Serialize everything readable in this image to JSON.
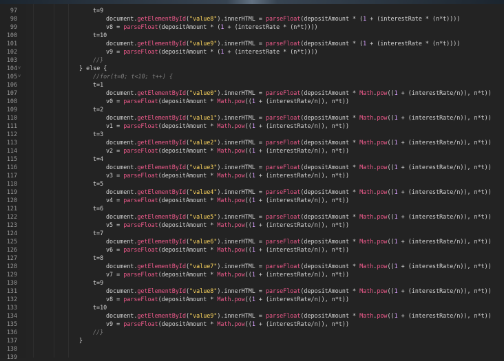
{
  "editor": {
    "lines": [
      {
        "n": "97",
        "code": "t=9",
        "indent": 0
      },
      {
        "n": "98",
        "code": "document.getElementById(\"value8\").innerHTML = parseFloat(depositAmount * (1 + (interestRate * (n*t))))",
        "indent": 1
      },
      {
        "n": "99",
        "code": "v8 = parseFloat(depositAmount * (1 + (interestRate * (n*t))))",
        "indent": 1
      },
      {
        "n": "100",
        "code": "t=10",
        "indent": 0
      },
      {
        "n": "101",
        "code": "document.getElementById(\"value9\").innerHTML = parseFloat(depositAmount * (1 + (interestRate * (n*t))))",
        "indent": 1
      },
      {
        "n": "102",
        "code": "v9 = parseFloat(depositAmount * (1 + (interestRate * (n*t))))",
        "indent": 1
      },
      {
        "n": "103",
        "code": "//}",
        "indent": 0,
        "comment": true
      },
      {
        "n": "104",
        "code": "} else {",
        "indent": -1,
        "fold": true
      },
      {
        "n": "105",
        "code": "//for(t=0; t<10; t++) {",
        "indent": 0,
        "comment": true,
        "fold": true
      },
      {
        "n": "106",
        "code": "t=1",
        "indent": 0
      },
      {
        "n": "107",
        "code": "document.getElementById(\"value0\").innerHTML = parseFloat(depositAmount * Math.pow((1 + (interestRate/n)), n*t))",
        "indent": 1
      },
      {
        "n": "108",
        "code": "v0 = parseFloat(depositAmount * Math.pow((1 + (interestRate/n)), n*t))",
        "indent": 1
      },
      {
        "n": "109",
        "code": "t=2",
        "indent": 0
      },
      {
        "n": "110",
        "code": "document.getElementById(\"value1\").innerHTML = parseFloat(depositAmount * Math.pow((1 + (interestRate/n)), n*t))",
        "indent": 1
      },
      {
        "n": "111",
        "code": "v1 = parseFloat(depositAmount * Math.pow((1 + (interestRate/n)), n*t))",
        "indent": 1
      },
      {
        "n": "112",
        "code": "t=3",
        "indent": 0
      },
      {
        "n": "113",
        "code": "document.getElementById(\"value2\").innerHTML = parseFloat(depositAmount * Math.pow((1 + (interestRate/n)), n*t))",
        "indent": 1
      },
      {
        "n": "114",
        "code": "v2 = parseFloat(depositAmount * Math.pow((1 + (interestRate/n)), n*t))",
        "indent": 1
      },
      {
        "n": "115",
        "code": "t=4",
        "indent": 0
      },
      {
        "n": "116",
        "code": "document.getElementById(\"value3\").innerHTML = parseFloat(depositAmount * Math.pow((1 + (interestRate/n)), n*t))",
        "indent": 1
      },
      {
        "n": "117",
        "code": "v3 = parseFloat(depositAmount * Math.pow((1 + (interestRate/n)), n*t))",
        "indent": 1
      },
      {
        "n": "118",
        "code": "t=5",
        "indent": 0
      },
      {
        "n": "119",
        "code": "document.getElementById(\"value4\").innerHTML = parseFloat(depositAmount * Math.pow((1 + (interestRate/n)), n*t))",
        "indent": 1
      },
      {
        "n": "120",
        "code": "v4 = parseFloat(depositAmount * Math.pow((1 + (interestRate/n)), n*t))",
        "indent": 1
      },
      {
        "n": "121",
        "code": "t=6",
        "indent": 0
      },
      {
        "n": "122",
        "code": "document.getElementById(\"value5\").innerHTML = parseFloat(depositAmount * Math.pow((1 + (interestRate/n)), n*t))",
        "indent": 1
      },
      {
        "n": "123",
        "code": "v5 = parseFloat(depositAmount * Math.pow((1 + (interestRate/n)), n*t))",
        "indent": 1
      },
      {
        "n": "124",
        "code": "t=7",
        "indent": 0
      },
      {
        "n": "125",
        "code": "document.getElementById(\"value6\").innerHTML = parseFloat(depositAmount * Math.pow((1 + (interestRate/n)), n*t))",
        "indent": 1
      },
      {
        "n": "126",
        "code": "v6 = parseFloat(depositAmount * Math.pow((1 + (interestRate/n)), n*t))",
        "indent": 1
      },
      {
        "n": "127",
        "code": "t=8",
        "indent": 0
      },
      {
        "n": "128",
        "code": "document.getElementById(\"value7\").innerHTML = parseFloat(depositAmount * Math.pow((1 + (interestRate/n)), n*t))",
        "indent": 1
      },
      {
        "n": "129",
        "code": "v7 = parseFloat(depositAmount * Math.pow((1 + (interestRate/n)), n*t))",
        "indent": 1
      },
      {
        "n": "130",
        "code": "t=9",
        "indent": 0
      },
      {
        "n": "131",
        "code": "document.getElementById(\"value8\").innerHTML = parseFloat(depositAmount * Math.pow((1 + (interestRate/n)), n*t))",
        "indent": 1
      },
      {
        "n": "132",
        "code": "v8 = parseFloat(depositAmount * Math.pow((1 + (interestRate/n)), n*t))",
        "indent": 1
      },
      {
        "n": "133",
        "code": "t=10",
        "indent": 0
      },
      {
        "n": "134",
        "code": "document.getElementById(\"value9\").innerHTML = parseFloat(depositAmount * Math.pow((1 + (interestRate/n)), n*t))",
        "indent": 1
      },
      {
        "n": "135",
        "code": "v9 = parseFloat(depositAmount * Math.pow((1 + (interestRate/n)), n*t))",
        "indent": 1
      },
      {
        "n": "136",
        "code": "//}",
        "indent": 0,
        "comment": true
      },
      {
        "n": "137",
        "code": "}",
        "indent": -1
      },
      {
        "n": "138",
        "code": "",
        "indent": -1
      },
      {
        "n": "139",
        "code": "",
        "indent": -1
      }
    ]
  },
  "colors": {
    "background": "#232323",
    "line_number": "#9a9a9a",
    "plain": "#d6d6d6",
    "function": "#f05a8c",
    "string": "#ffd75f",
    "number": "#d9a0ff",
    "comment": "#7f7f7f"
  },
  "icons": {
    "fold": "fold-caret-icon"
  }
}
